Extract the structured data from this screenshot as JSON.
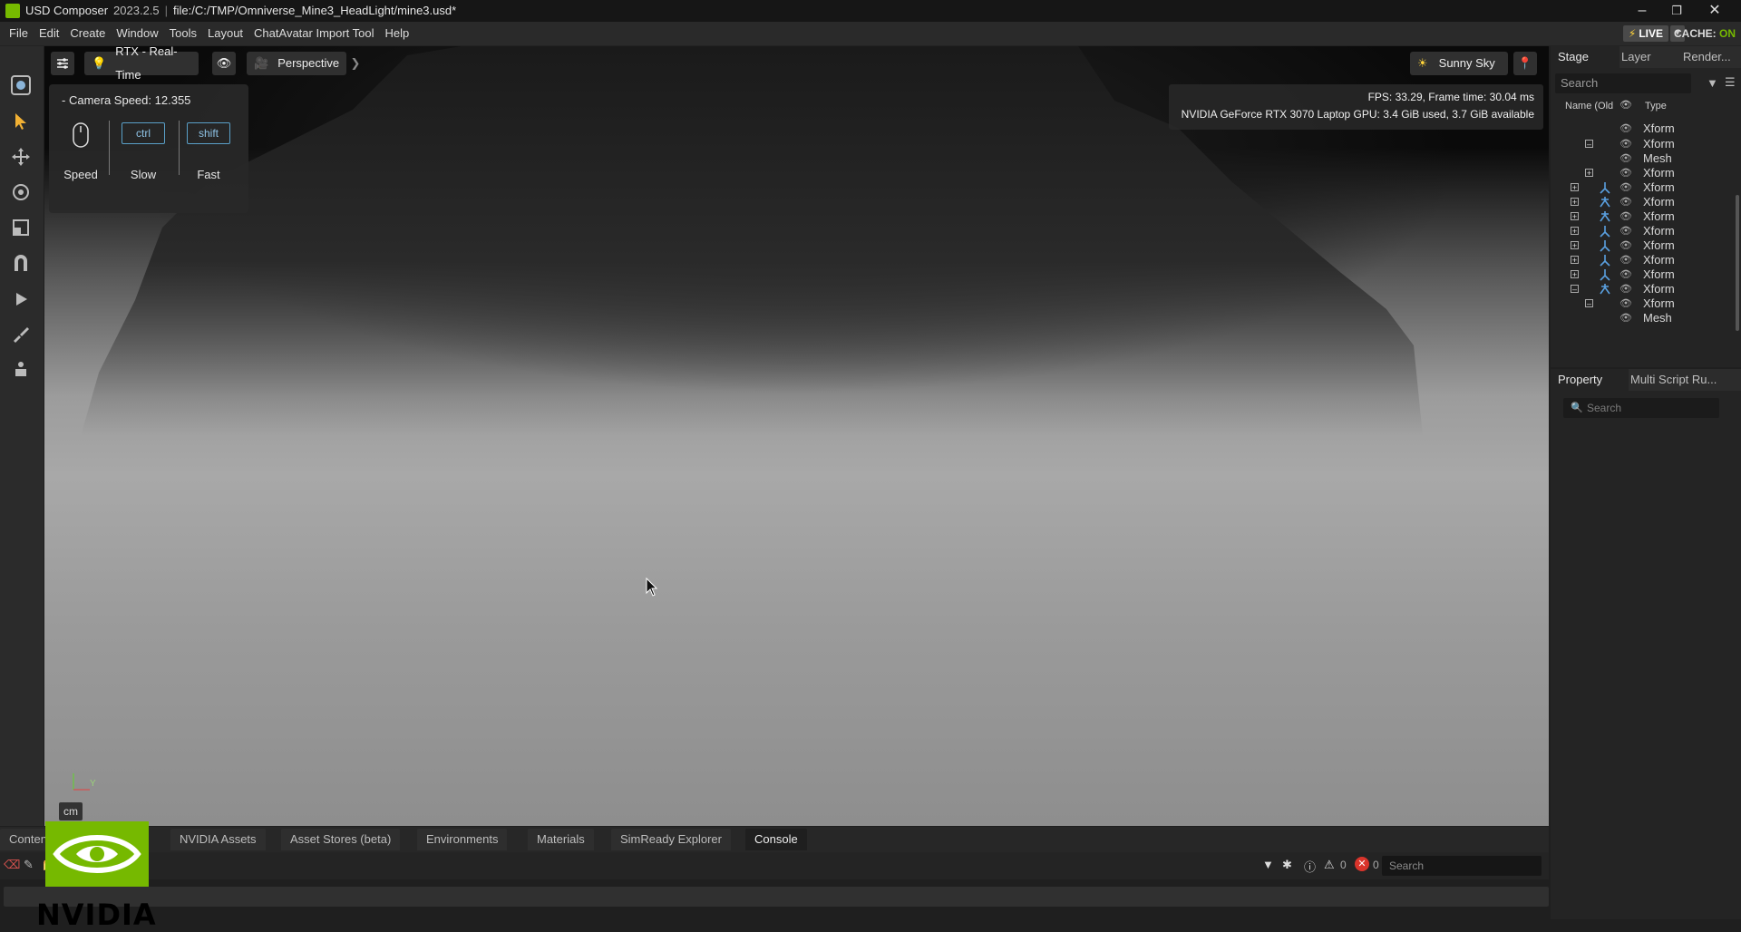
{
  "app": {
    "name": "USD Composer",
    "version": "2023.2.5",
    "file_path": "file:/C:/TMP/Omniverse_Mine3_HeadLight/mine3.usd*"
  },
  "menu": [
    "File",
    "Edit",
    "Create",
    "Window",
    "Tools",
    "Layout",
    "ChatAvatar Import Tool",
    "Help"
  ],
  "status": {
    "live_label": "LIVE",
    "cache_label": "CACHE:",
    "cache_state": "ON"
  },
  "viewport": {
    "renderer": "RTX - Real-Time",
    "camera": "Perspective",
    "environment": "Sunny Sky",
    "camera_speed_label": "Camera Speed:",
    "camera_speed_value": "12.355",
    "keys": {
      "ctrl": "ctrl",
      "shift": "shift"
    },
    "speed_labels": {
      "speed": "Speed",
      "slow": "Slow",
      "fast": "Fast"
    },
    "fps_line": "FPS: 33.29, Frame time: 30.04 ms",
    "gpu_line": "NVIDIA GeForce RTX 3070 Laptop GPU: 3.4 GiB used, 3.7 GiB available",
    "unit_label": "cm",
    "axis_label": "Y"
  },
  "stage": {
    "tabs": [
      "Stage",
      "Layer",
      "Render..."
    ],
    "search_placeholder": "Search",
    "col_name": "Name (Old",
    "col_type": "Type",
    "rows": [
      {
        "type": "Xform"
      },
      {
        "type": "Xform"
      },
      {
        "type": "Mesh"
      },
      {
        "type": "Xform"
      },
      {
        "type": "Xform"
      },
      {
        "type": "Xform"
      },
      {
        "type": "Xform"
      },
      {
        "type": "Xform"
      },
      {
        "type": "Xform"
      },
      {
        "type": "Xform"
      },
      {
        "type": "Xform"
      },
      {
        "type": "Xform"
      },
      {
        "type": "Xform"
      },
      {
        "type": "Mesh"
      }
    ]
  },
  "property": {
    "tabs": [
      "Property",
      "Multi Script Ru..."
    ],
    "search_placeholder": "Search"
  },
  "bottom": {
    "tabs": [
      "Content",
      "NVIDIA Assets",
      "Asset Stores (beta)",
      "Environments",
      "Materials",
      "SimReady Explorer",
      "Console"
    ],
    "warn_count": "0",
    "error_count": "0",
    "search_placeholder": "Search"
  },
  "logo": {
    "text": "NVIDIA"
  },
  "colors": {
    "accent": "#76b900",
    "error": "#d9342b",
    "key_outline": "#5aa0c8"
  }
}
